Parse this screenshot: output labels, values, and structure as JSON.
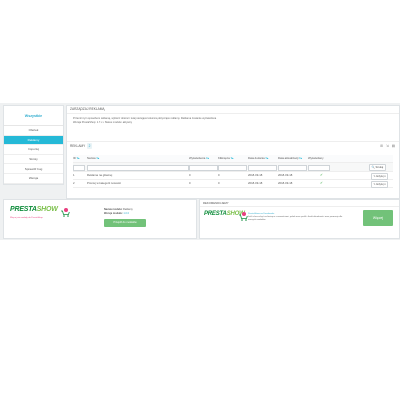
{
  "sidebar": {
    "title": "Wszystkie",
    "items": [
      {
        "label": "Ofertek"
      },
      {
        "label": "Reklamy"
      },
      {
        "label": "Importuj"
      },
      {
        "label": "Skroty"
      },
      {
        "label": "Sprawdź bug"
      },
      {
        "label": "Wersja"
      }
    ]
  },
  "panel": {
    "header": "ZARZĄDZAJ REKLAMĄ",
    "info_line1": "Przemiń tym sposobem reklamą, wybierz obszar i tutaj sterujące kolumną dotyczące reklamy. Reklama zostanie wyświetlona",
    "info_line2": "Wersja PrestaShop: 1.7.x • Status modułu: aktywny",
    "list_title": "REKLAMY",
    "list_count": "2",
    "columns": [
      "ID",
      "Nazwa",
      "Wyświetlenia",
      "Kliknięcia",
      "Data dodania",
      "Data aktualizacji",
      "Wyświetlany"
    ],
    "filter_button": "Szukaj",
    "rows": [
      {
        "id": "1",
        "name": "Reklama na głównej",
        "views": "0",
        "clicks": "0",
        "added": "2018-09-18",
        "updated": "2018-09-18",
        "edit": "Edytuj"
      },
      {
        "id": "2",
        "name": "Promuj w kategorii nowości",
        "views": "0",
        "clicks": "0",
        "added": "2018-09-18",
        "updated": "2018-09-18",
        "edit": "Edytuj"
      }
    ]
  },
  "promo_left": {
    "logo_presta": "PRESTA",
    "logo_show": "SHOW",
    "tagline": "Więcej niż moduły do PrestaShop",
    "module_name_label": "Nazwa modułu:",
    "module_name_value": "Reklamy",
    "module_version_label": "Wersja modułu:",
    "module_version_value": "1.0.0",
    "button_label": "Przejdź do modułów"
  },
  "promo_right": {
    "title": "REKOMENDUJEMY",
    "logo_presta": "PRESTA",
    "logo_show": "SHOW",
    "lead": "PrestaShow na Facebooku",
    "text": "Jeśli chcesz być na bieżąco z nowościami, polub nasz profil i śledź aktualności oraz promocje dla naszych modułów.",
    "button_label": "Więcej"
  },
  "colors": {
    "accent": "#25b9d7",
    "green": "#72c279",
    "brand_dark": "#0f8c3b",
    "brand_light": "#7cc04b"
  }
}
